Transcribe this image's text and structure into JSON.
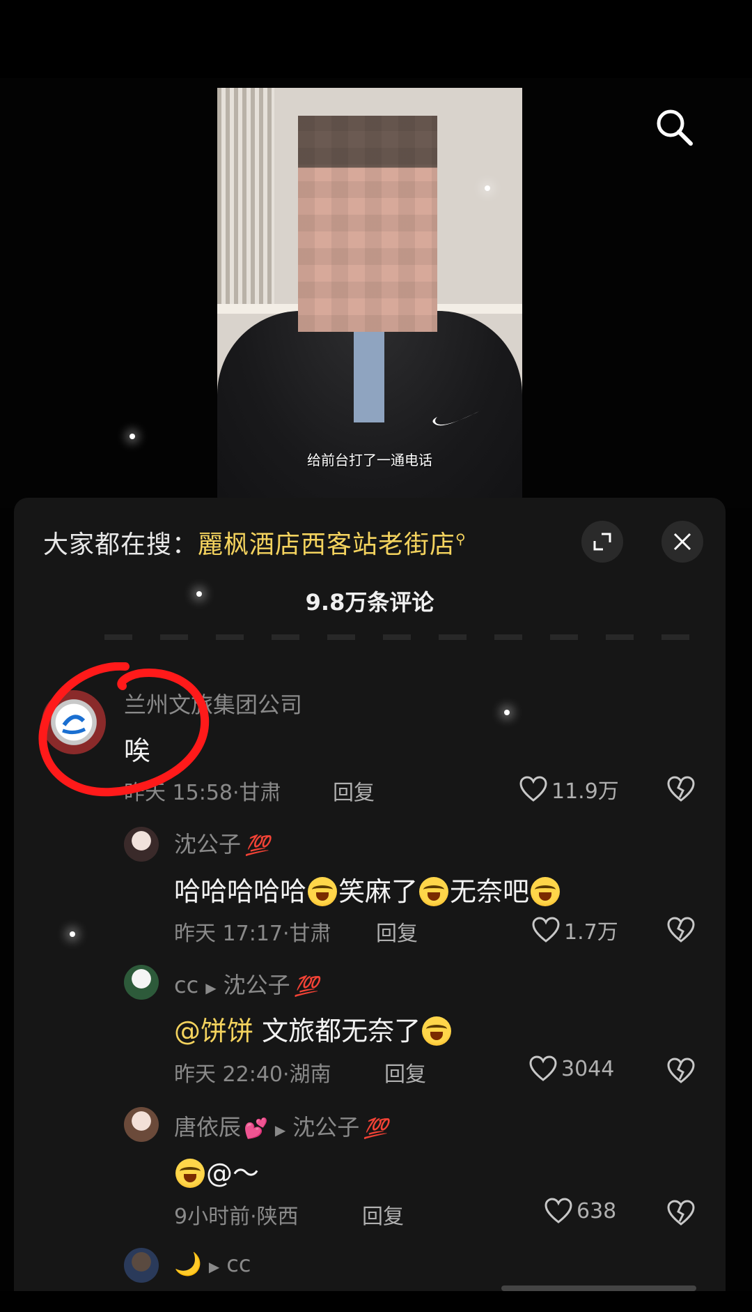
{
  "video": {
    "caption": "给前台打了一通电话"
  },
  "sheet": {
    "search_hint_label": "大家都在搜：",
    "search_hint_term": "麗枫酒店西客站老街店",
    "comment_count": "9.8万条评论"
  },
  "comments": [
    {
      "username": "兰州文旅集团公司",
      "text": "唉",
      "time": "昨天 15:58",
      "location": "甘肃",
      "reply_label": "回复",
      "likes": "11.9万"
    },
    {
      "username": "沈公子",
      "badge": "💯",
      "text_parts": [
        "哈哈哈哈哈",
        "笑麻了",
        "无奈吧"
      ],
      "time": "昨天 17:17",
      "location": "甘肃",
      "reply_label": "回复",
      "likes": "1.7万"
    },
    {
      "username": "cc",
      "reply_to": "沈公子",
      "badge": "💯",
      "mention": "@饼饼",
      "text": "文旅都无奈了",
      "time": "昨天 22:40",
      "location": "湖南",
      "reply_label": "回复",
      "likes": "3044"
    },
    {
      "username": "唐依辰",
      "user_emoji": "💕",
      "reply_to": "沈公子",
      "badge": "💯",
      "text": "@～",
      "time": "9小时前",
      "location": "陕西",
      "reply_label": "回复",
      "likes": "638"
    },
    {
      "username": "🌙",
      "reply_to": "cc"
    }
  ]
}
